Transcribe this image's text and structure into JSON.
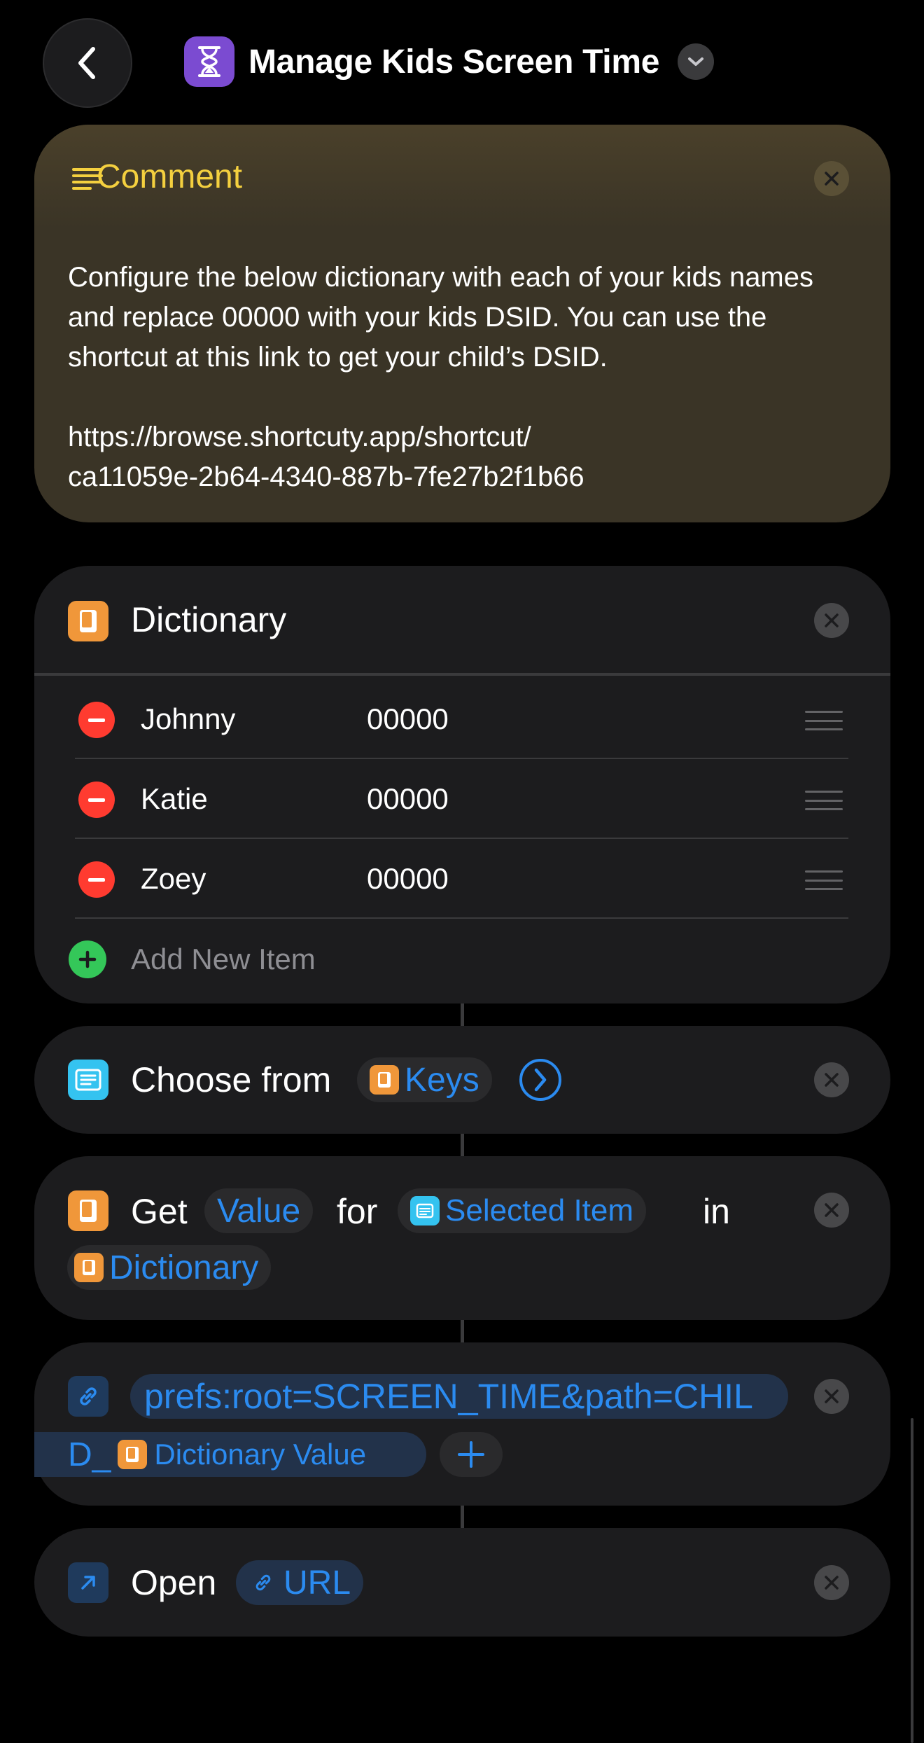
{
  "header": {
    "title": "Manage Kids Screen Time",
    "icons": {
      "back": "chevron-left-icon",
      "app": "hourglass-icon",
      "menu": "chevron-down-icon"
    }
  },
  "comment": {
    "title": "Comment",
    "text": "Configure the below dictionary with each of your kids names and replace 00000 with your kids DSID. You can use the shortcut at this link to get your child’s DSID.\n\nhttps://browse.shortcuty.app/shortcut/\nca11059e-2b64-4340-887b-7fe27b2f1b66",
    "accent": "#f4d03f"
  },
  "dictionary": {
    "title": "Dictionary",
    "items": [
      {
        "key": "Johnny",
        "value": "00000"
      },
      {
        "key": "Katie",
        "value": "00000"
      },
      {
        "key": "Zoey",
        "value": "00000"
      }
    ],
    "add_label": "Add New Item"
  },
  "choose": {
    "label": "Choose from",
    "token": "Keys"
  },
  "get_value": {
    "label_get": "Get",
    "token_value": "Value",
    "label_for": "for",
    "token_selected": "Selected Item",
    "label_in": "in",
    "token_dictionary": "Dictionary"
  },
  "url_action": {
    "text_line1": "prefs:root=SCREEN_TIME&path=CHIL",
    "text_line2": "D_",
    "token": "Dictionary Value"
  },
  "open_action": {
    "label": "Open",
    "token": "URL"
  },
  "colors": {
    "accent_blue": "#2b8bf0",
    "orange": "#f0973a",
    "red": "#ff3b30",
    "green": "#34c759"
  }
}
